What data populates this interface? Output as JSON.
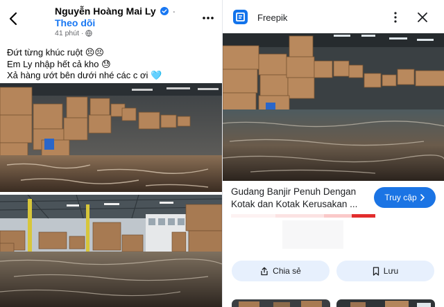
{
  "post": {
    "author_name": "Nguyễn Hoàng Mai Ly",
    "follow_label": "Theo dõi",
    "time_ago": "41 phút",
    "caption_lines": [
      "Đứt từng khúc ruột 😣😣",
      "Em Ly nhập hết cả kho 😓",
      "Xả hàng ướt bên dưới nhé các c ơi 🩵"
    ]
  },
  "viewer": {
    "app_name": "Freepik",
    "title": "Gudang Banjir Penuh Dengan Kotak dan Kotak Kerusakan ...",
    "visit_label": "Truy cập",
    "share_label": "Chia sẻ",
    "save_label": "Lưu"
  },
  "colors": {
    "accent": "#1b74e4",
    "follow": "#1877f2",
    "secondary_button": "#e7f0fd"
  },
  "icons": [
    "back-arrow-icon",
    "verified-badge-icon",
    "globe-icon",
    "more-icon",
    "freepik-logo-icon",
    "kebab-icon",
    "close-icon",
    "chevron-right-icon",
    "share-icon",
    "bookmark-icon"
  ]
}
